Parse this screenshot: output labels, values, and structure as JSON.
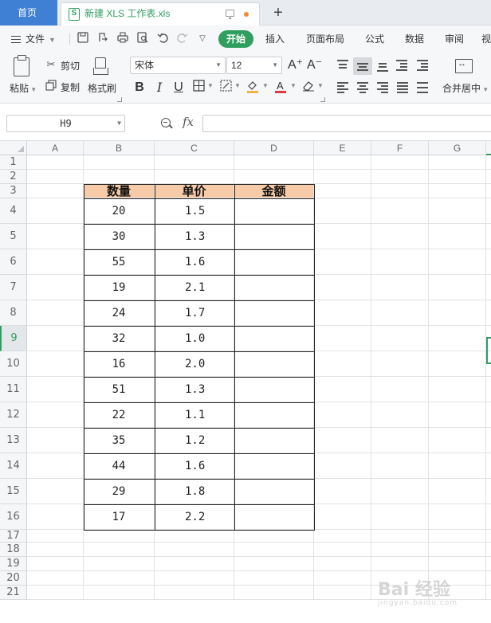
{
  "titlebar": {
    "home_tab": "首页",
    "file_icon": "S",
    "file_name": "新建 XLS 工作表.xls",
    "new_tab": "+"
  },
  "menubar": {
    "file_label": "文件",
    "start_label": "开始",
    "items": [
      "插入",
      "页面布局",
      "公式",
      "数据",
      "审阅",
      "视"
    ]
  },
  "ribbon": {
    "paste_label": "粘贴",
    "cut_label": "剪切",
    "copy_label": "复制",
    "format_painter_label": "格式刷",
    "font_name": "宋体",
    "font_size": "12",
    "grow_font": "A⁺",
    "shrink_font": "A⁻",
    "bold": "B",
    "italic": "I",
    "underline": "U",
    "merge_label": "合并居中"
  },
  "formula_bar": {
    "name_box": "H9",
    "fx_label": "fx",
    "value": ""
  },
  "sheet": {
    "columns": [
      "A",
      "B",
      "C",
      "D",
      "E",
      "F",
      "G"
    ],
    "rows": [
      "1",
      "2",
      "3",
      "4",
      "5",
      "6",
      "7",
      "8",
      "9",
      "10",
      "11",
      "12",
      "13",
      "14",
      "15",
      "16",
      "17",
      "18",
      "19",
      "20",
      "21"
    ],
    "active_cell": "H9",
    "table_header": [
      "数量",
      "单价",
      "金额"
    ],
    "table_rows": [
      [
        "20",
        "1.5",
        ""
      ],
      [
        "30",
        "1.3",
        ""
      ],
      [
        "55",
        "1.6",
        ""
      ],
      [
        "19",
        "2.1",
        ""
      ],
      [
        "24",
        "1.7",
        ""
      ],
      [
        "32",
        "1.0",
        ""
      ],
      [
        "16",
        "2.0",
        ""
      ],
      [
        "51",
        "1.3",
        ""
      ],
      [
        "22",
        "1.1",
        ""
      ],
      [
        "35",
        "1.2",
        ""
      ],
      [
        "44",
        "1.6",
        ""
      ],
      [
        "29",
        "1.8",
        ""
      ],
      [
        "17",
        "2.2",
        ""
      ]
    ],
    "header_fill": "#f8cba8",
    "accent": "#2f9e5f"
  },
  "watermark": {
    "text": "Bai 经验",
    "sub": "jingyan.baidu.com"
  }
}
